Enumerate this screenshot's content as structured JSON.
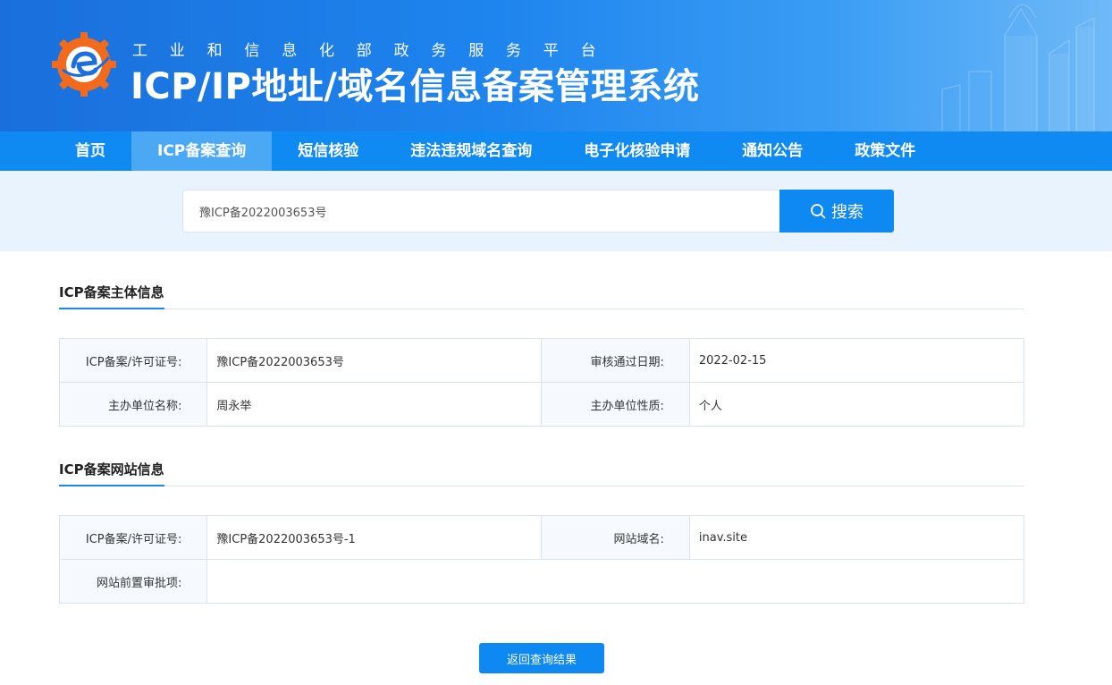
{
  "header": {
    "subtitle": "工业和信息化部政务服务平台",
    "title": "ICP/IP地址/域名信息备案管理系统"
  },
  "nav": {
    "items": [
      "首页",
      "ICP备案查询",
      "短信核验",
      "违法违规域名查询",
      "电子化核验申请",
      "通知公告",
      "政策文件"
    ],
    "active": "ICP备案查询"
  },
  "search": {
    "value": "豫ICP备2022003653号",
    "button_label": "搜索"
  },
  "entity_section": {
    "title": "ICP备案主体信息",
    "license_label": "ICP备案/许可证号:",
    "license_value": "豫ICP备2022003653号",
    "approve_label": "审核通过日期:",
    "approve_value": "2022-02-15",
    "org_name_label": "主办单位名称:",
    "org_name_value": "周永举",
    "org_type_label": "主办单位性质:",
    "org_type_value": "个人"
  },
  "site_section": {
    "title": "ICP备案网站信息",
    "license_label": "ICP备案/许可证号:",
    "license_value": "豫ICP备2022003653号-1",
    "domain_label": "网站域名:",
    "domain_value": "inav.site",
    "preapproval_label": "网站前置审批项:",
    "preapproval_value": ""
  },
  "back_button_label": "返回查询结果",
  "colors": {
    "primary": "#0e89f2",
    "nav_bg": "#0f8af3",
    "nav_active": "#4aa8f5",
    "search_band": "#e8f3fd",
    "logo_orange": "#f26a1b"
  }
}
